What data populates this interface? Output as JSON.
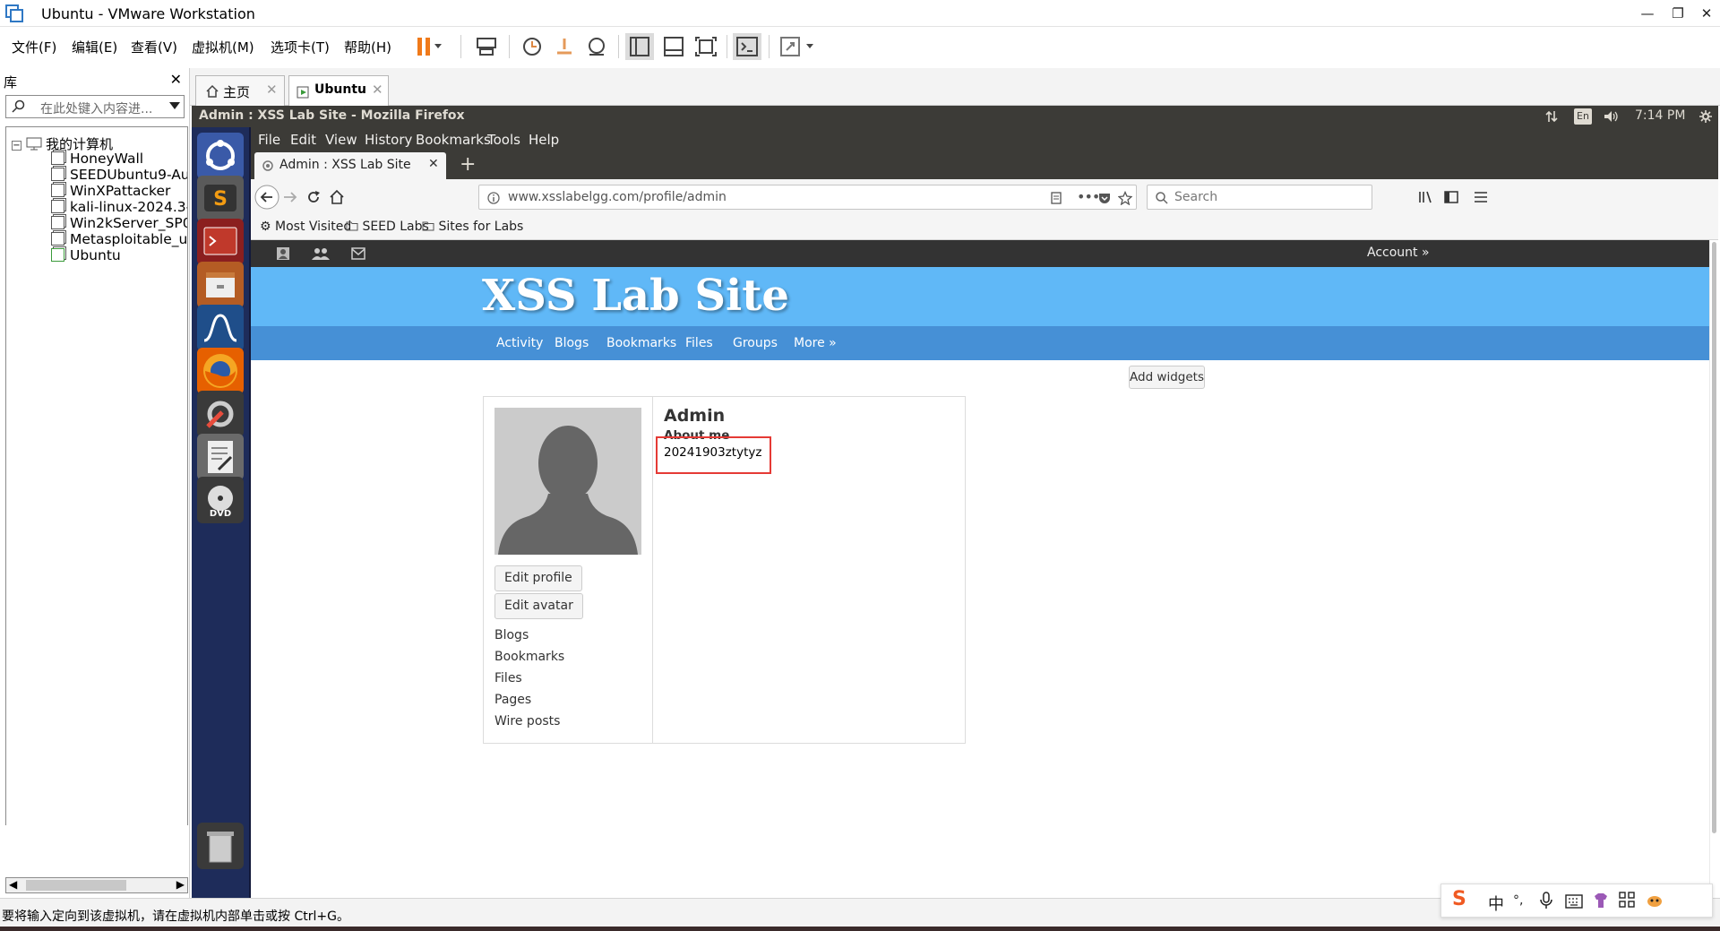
{
  "vm": {
    "window_title": "Ubuntu - VMware Workstation",
    "menus": [
      "文件(F)",
      "编辑(E)",
      "查看(V)",
      "虚拟机(M)",
      "选项卡(T)",
      "帮助(H)"
    ],
    "library": {
      "title": "库",
      "search_placeholder": "在此处键入内容进...",
      "root": "我的计算机",
      "items": [
        "HoneyWall",
        "SEEDUbuntu9-Au",
        "WinXPattacker",
        "kali-linux-2024.3-",
        "Win2kServer_SP0",
        "Metasploitable_u",
        "Ubuntu"
      ]
    },
    "tabs": [
      {
        "label": "主页"
      },
      {
        "label": "Ubuntu"
      }
    ],
    "status_text": "要将输入定向到该虚拟机，请在虚拟机内部单击或按 Ctrl+G。",
    "ime": {
      "lang": "中",
      "punct": "°,"
    }
  },
  "ubuntu": {
    "window_title": "Admin : XSS Lab Site - Mozilla Firefox",
    "lang": "En",
    "time": "7:14 PM"
  },
  "firefox": {
    "menus": [
      "File",
      "Edit",
      "View",
      "History",
      "Bookmarks",
      "Tools",
      "Help"
    ],
    "tab_title": "Admin : XSS Lab Site",
    "url": "www.xsslabelgg.com/profile/admin",
    "search_placeholder": "Search",
    "bookmarks": [
      "Most Visited",
      "SEED Labs",
      "Sites for Labs"
    ]
  },
  "site": {
    "account": "Account »",
    "title": "XSS Lab Site",
    "nav": [
      "Activity",
      "Blogs",
      "Bookmarks",
      "Files",
      "Groups",
      "More »"
    ],
    "add_widgets": "Add widgets",
    "profile": {
      "name": "Admin",
      "about_label": "About me",
      "about_value": "20241903ztytyz",
      "buttons": [
        "Edit profile",
        "Edit avatar"
      ],
      "links": [
        "Blogs",
        "Bookmarks",
        "Files",
        "Pages",
        "Wire posts"
      ]
    }
  }
}
